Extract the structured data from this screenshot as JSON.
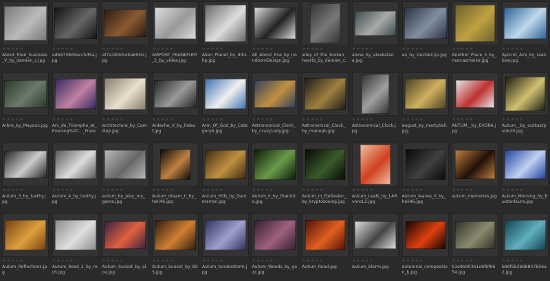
{
  "colors": {
    "background": "#2a2a2a",
    "label": "#b8b8b8",
    "star_off": "#4a4a4a"
  },
  "thumbnails": [
    {
      "label": "About_their_business_V_by_damien_c.jpg",
      "bg": "#777",
      "fg": "#bbb",
      "w": 62,
      "h": 50
    },
    {
      "label": "adb8738d3ecc5d5a.jpg",
      "bg": "#111",
      "fg": "#666",
      "w": 62,
      "h": 46
    },
    {
      "label": "af7a180b540a695b.jpg",
      "bg": "#2a1a12",
      "fg": "#8a5a30",
      "w": 62,
      "h": 40
    },
    {
      "label": "AIRPORT_FRANKFURT_2_by_videa.jpg",
      "bg": "#dddddd",
      "fg": "#999",
      "w": 60,
      "h": 46
    },
    {
      "label": "Alien_Planet_by_drkshp.jpg",
      "bg": "#666",
      "fg": "#ddd",
      "w": 60,
      "h": 54
    },
    {
      "label": "All_About_Eve_by_IrondoomDesign.jpg",
      "bg": "#e0e0e0",
      "fg": "#222",
      "w": 60,
      "h": 46
    },
    {
      "label": "alley_of_the_broken_hearts_by_damien_c.jpg",
      "bg": "#333",
      "fg": "#777",
      "w": 44,
      "h": 58
    },
    {
      "label": "alone_by_alexkatana.jpg",
      "bg": "#3a4a4a",
      "fg": "#aaa",
      "w": 60,
      "h": 36
    },
    {
      "label": "an_by_GozDeCyp.jpg",
      "bg": "#2a3040",
      "fg": "#8090a0",
      "w": 62,
      "h": 46
    },
    {
      "label": "Another_Place_5_by_marcazmeilor.jpg",
      "bg": "#6a6030",
      "fg": "#c0a040",
      "w": 58,
      "h": 54
    },
    {
      "label": "Apricot_Airs_by_raenbow.jpg",
      "bg": "#2a6090",
      "fg": "#bfd8ee",
      "w": 62,
      "h": 46
    },
    {
      "label": "Arbre_by_Mayoux.jpg",
      "bg": "#2a3a2a",
      "fg": "#6a7a6a",
      "w": 62,
      "h": 40
    },
    {
      "label": "Arc_de_Triomphe_at_Evening%2C..._France.jpg",
      "bg": "#302860",
      "fg": "#c080a0",
      "w": 60,
      "h": 44
    },
    {
      "label": "architecture_by_CamilleJr.jpg",
      "bg": "#8a7a6a",
      "fg": "#e8e0d0",
      "w": 60,
      "h": 46
    },
    {
      "label": "Ardeche_V_by_Paleuf.jpg",
      "bg": "#222",
      "fg": "#999",
      "w": 62,
      "h": 40
    },
    {
      "label": "Arm_Of_God_by_Category6.jpg",
      "bg": "#3a70b0",
      "fg": "#f0f0f0",
      "w": 60,
      "h": 44
    },
    {
      "label": "Astronomical_Clock_by_crazy1ady.jpg",
      "bg": "#304060",
      "fg": "#c09040",
      "w": 60,
      "h": 40
    },
    {
      "label": "Astronomical_Clock_by_manepb.jpg",
      "bg": "#1a1a1a",
      "fg": "#a08040",
      "w": 60,
      "h": 46
    },
    {
      "label": "Astronomical_Clock.jpg",
      "bg": "#303030",
      "fg": "#a0a0a0",
      "w": 40,
      "h": 58
    },
    {
      "label": "august_by_martybell.jpg",
      "bg": "#4a4020",
      "fg": "#d0b060",
      "w": 60,
      "h": 44
    },
    {
      "label": "AUTUM__by_EVORA.jpg",
      "bg": "#e8e8e8",
      "fg": "#c03030",
      "w": 56,
      "h": 40
    },
    {
      "label": "Autum__by_outkastpunk20.jpg",
      "bg": "#1a1a10",
      "fg": "#d0c070",
      "w": 58,
      "h": 50
    },
    {
      "label": "Autum_3_by_luethy.jpg",
      "bg": "#222",
      "fg": "#ccc",
      "w": 62,
      "h": 40
    },
    {
      "label": "Autum_4_by_luethy.jpg",
      "bg": "#555",
      "fg": "#ddd",
      "w": 60,
      "h": 42
    },
    {
      "label": "autum_by_play_my_game.jpg",
      "bg": "#bbbbbb",
      "fg": "#666",
      "w": 60,
      "h": 42
    },
    {
      "label": "Autum_dream_II_by_heli46.jpg",
      "bg": "#0a0a0a",
      "fg": "#c08040",
      "w": 44,
      "h": 44
    },
    {
      "label": "Autum_Hills_by_Dammarran.jpg",
      "bg": "#3a2a10",
      "fg": "#c09040",
      "w": 60,
      "h": 42
    },
    {
      "label": "Autum_II_by_thanicka.jpg",
      "bg": "#0a1a0a",
      "fg": "#6a9a4a",
      "w": 60,
      "h": 44
    },
    {
      "label": "Autum_in_Fjellveien_by_kryptozoolog.jpg",
      "bg": "#050805",
      "fg": "#3a5a2a",
      "w": 58,
      "h": 44
    },
    {
      "label": "Autum_Leafs_by_LARvoncL2.jpg",
      "bg": "#f0c0a0",
      "fg": "#d04020",
      "w": 44,
      "h": 58
    },
    {
      "label": "Autum_leaves_II_by_heli46.jpg",
      "bg": "#080808",
      "fg": "#404040",
      "w": 58,
      "h": 44
    },
    {
      "label": "autum_memories.jpg",
      "bg": "#c08040",
      "fg": "#201008",
      "w": 58,
      "h": 42
    },
    {
      "label": "Autum_Morning_by_buxtonlaura.jpg",
      "bg": "#2040a0",
      "fg": "#c0d0f0",
      "w": 60,
      "h": 42
    },
    {
      "label": "Autum_Reflections.jpg",
      "bg": "#704010",
      "fg": "#e0a040",
      "w": 60,
      "h": 44
    },
    {
      "label": "Autum_Road_2_by_rech.jpg",
      "bg": "#8a8a8a",
      "fg": "#e0e0e0",
      "w": 60,
      "h": 44
    },
    {
      "label": "Autum_Sunset_by_alce.jpg",
      "bg": "#3a2040",
      "fg": "#e06040",
      "w": 60,
      "h": 40
    },
    {
      "label": "Autum_Sunset_by_BSS.jpg",
      "bg": "#2a1a10",
      "fg": "#d08030",
      "w": 60,
      "h": 44
    },
    {
      "label": "Autum_tunderstorm.jpg",
      "bg": "#303060",
      "fg": "#a0a0d0",
      "w": 60,
      "h": 44
    },
    {
      "label": "Autum_Woods_by_gazz.jpg",
      "bg": "#302030",
      "fg": "#a06080",
      "w": 60,
      "h": 44
    },
    {
      "label": "Autum_Road.jpg",
      "bg": "#501008",
      "fg": "#e06020",
      "w": 58,
      "h": 44
    },
    {
      "label": "Autum_Storm.jpg",
      "bg": "#e0e0e0",
      "fg": "#444",
      "w": 60,
      "h": 40
    },
    {
      "label": "autumnal_composition_b.jpg",
      "bg": "#100400",
      "fg": "#e04010",
      "w": 58,
      "h": 40
    },
    {
      "label": "b1e9b903b1ebfbf6654.jpg",
      "bg": "#303028",
      "fg": "#8a8a70",
      "w": 58,
      "h": 40
    },
    {
      "label": "b96f5b2b96847856a2.jpg",
      "bg": "#104050",
      "fg": "#60b0c0",
      "w": 60,
      "h": 44
    }
  ]
}
